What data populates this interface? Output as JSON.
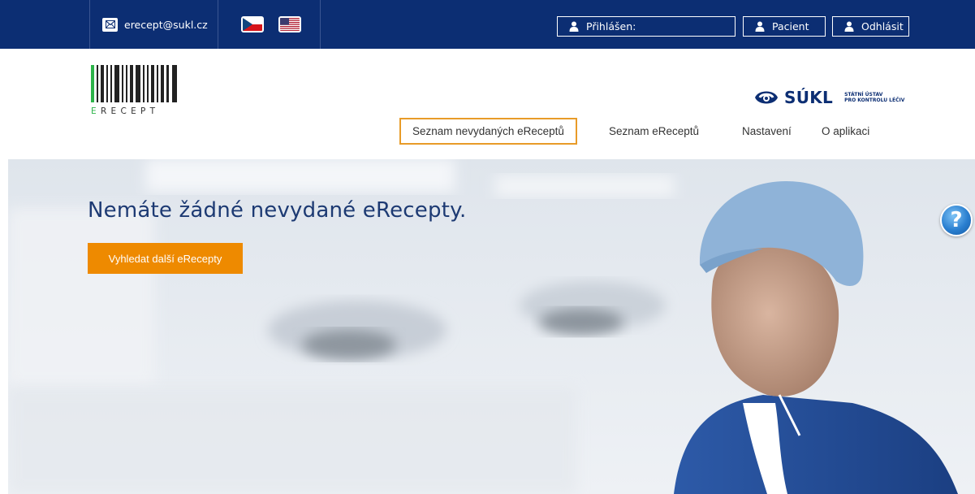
{
  "topbar": {
    "email": "erecept@sukl.cz",
    "logged_in_label": "Přihlášen:",
    "patient_label": "Pacient",
    "logout_label": "Odhlásit",
    "bg_color": "#0c2e73",
    "flags": [
      "cz-flag-icon",
      "us-flag-icon"
    ]
  },
  "logo": {
    "first_letter": "E",
    "rest": "RECEPT"
  },
  "sukl": {
    "name": "SÚKL",
    "sub_line1": "STÁTNÍ ÚSTAV",
    "sub_line2": "PRO KONTROLU LÉČIV"
  },
  "nav": {
    "items": [
      {
        "label": "Seznam nevydaných eReceptů",
        "active": true
      },
      {
        "label": "Seznam eReceptů",
        "active": false
      },
      {
        "label": "Nastavení",
        "active": false
      },
      {
        "label": "O aplikaci",
        "active": false
      }
    ],
    "active_border_color": "#e89b28"
  },
  "hero": {
    "title": "Nemáte žádné nevydané eRecepty.",
    "button_label": "Vyhledat další eRecepty",
    "button_color": "#ee8a00"
  },
  "help": {
    "symbol": "?"
  }
}
